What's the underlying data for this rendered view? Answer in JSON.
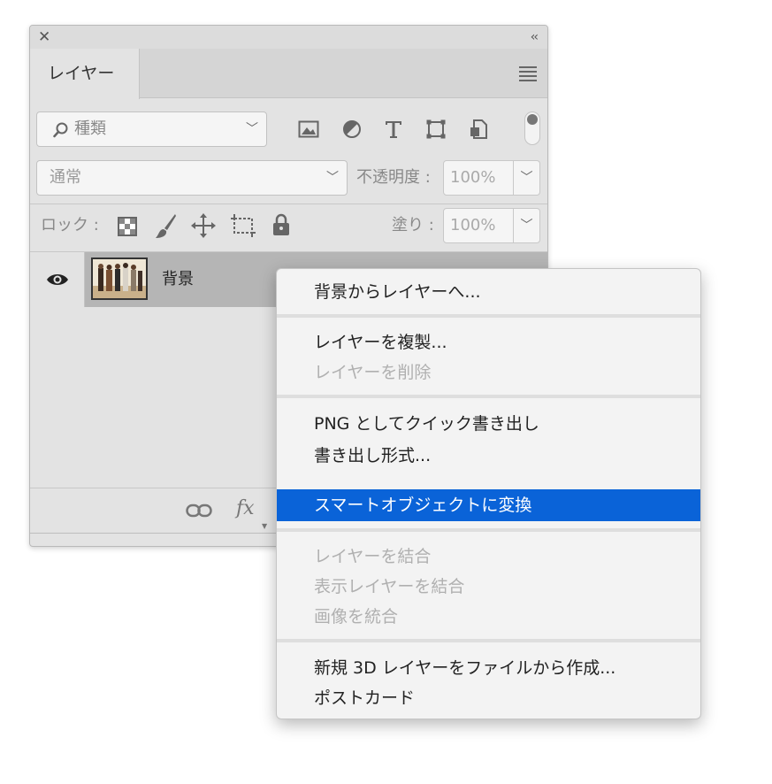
{
  "panel": {
    "close_glyph": "✕",
    "collapse_glyph": "‹‹",
    "tab_label": "レイヤー",
    "filter": {
      "icon": "search-icon",
      "label": "種類"
    },
    "blend_mode": "通常",
    "opacity_label": "不透明度 :",
    "opacity_value": "100%",
    "lock_label": "ロック :",
    "fill_label": "塗り :",
    "fill_value": "100%",
    "layer": {
      "name": "背景",
      "visible": true
    },
    "bottom": {
      "fx_label": "fx"
    }
  },
  "context_menu": {
    "items": [
      {
        "label": "背景からレイヤーへ...",
        "enabled": true
      },
      {
        "label": "レイヤーを複製...",
        "enabled": true
      },
      {
        "label": "レイヤーを削除",
        "enabled": false
      },
      {
        "label": "PNG としてクイック書き出し",
        "enabled": true
      },
      {
        "label": "書き出し形式...",
        "enabled": true
      },
      {
        "label": "スマートオブジェクトに変換",
        "enabled": true,
        "highlighted": true
      },
      {
        "label": "レイヤーを結合",
        "enabled": false
      },
      {
        "label": "表示レイヤーを結合",
        "enabled": false
      },
      {
        "label": "画像を統合",
        "enabled": false
      },
      {
        "label": "新規 3D レイヤーをファイルから作成...",
        "enabled": true
      },
      {
        "label": "ポストカード",
        "enabled": true
      }
    ]
  },
  "colors": {
    "highlight": "#0a63d8",
    "disabled_text": "#b0b0b0"
  }
}
